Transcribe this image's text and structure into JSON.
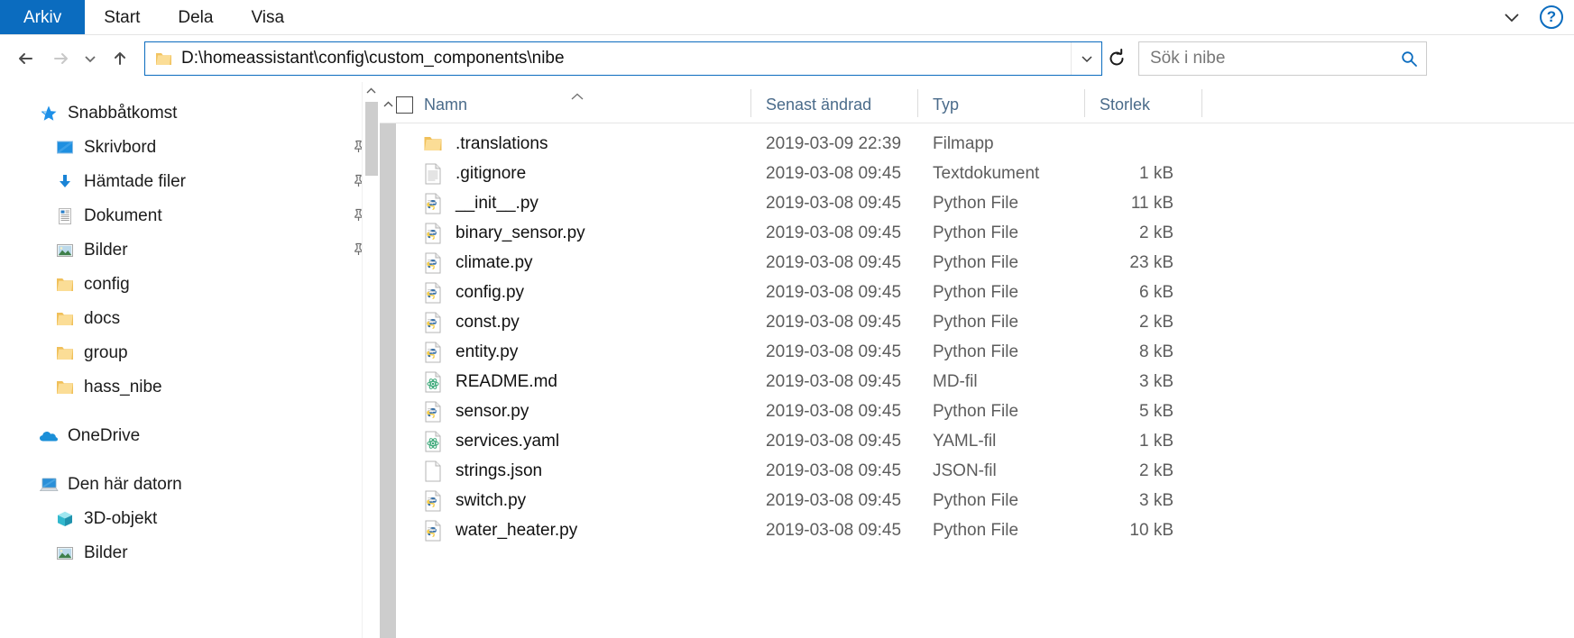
{
  "ribbon": {
    "tabs": [
      {
        "label": "Arkiv",
        "active": true
      },
      {
        "label": "Start",
        "active": false
      },
      {
        "label": "Dela",
        "active": false
      },
      {
        "label": "Visa",
        "active": false
      }
    ],
    "collapse_icon": "chevron-down-icon",
    "help_label": "?"
  },
  "toolbar": {
    "back_glyph": "←",
    "forward_glyph": "→",
    "recent_glyph": "⌄",
    "up_glyph": "↑",
    "refresh_glyph": "↻",
    "address_value": "D:\\homeassistant\\config\\custom_components\\nibe",
    "address_chevron": "⌄",
    "search_placeholder": "Sök i nibe",
    "search_icon": "search-icon"
  },
  "sidebar": {
    "groups": [
      {
        "name": "quick-access",
        "items": [
          {
            "label": "Snabbåtkomst",
            "icon": "star-icon",
            "level": 0,
            "pinned": false
          },
          {
            "label": "Skrivbord",
            "icon": "desktop-icon",
            "level": 1,
            "pinned": true
          },
          {
            "label": "Hämtade filer",
            "icon": "downloads-icon",
            "level": 1,
            "pinned": true
          },
          {
            "label": "Dokument",
            "icon": "documents-icon",
            "level": 1,
            "pinned": true
          },
          {
            "label": "Bilder",
            "icon": "pictures-icon",
            "level": 1,
            "pinned": true
          },
          {
            "label": "config",
            "icon": "folder-icon",
            "level": 1,
            "pinned": false
          },
          {
            "label": "docs",
            "icon": "folder-icon",
            "level": 1,
            "pinned": false
          },
          {
            "label": "group",
            "icon": "folder-icon",
            "level": 1,
            "pinned": false
          },
          {
            "label": "hass_nibe",
            "icon": "folder-icon",
            "level": 1,
            "pinned": false
          }
        ]
      },
      {
        "name": "onedrive",
        "items": [
          {
            "label": "OneDrive",
            "icon": "cloud-icon",
            "level": 0,
            "pinned": false
          }
        ]
      },
      {
        "name": "this-pc",
        "items": [
          {
            "label": "Den här datorn",
            "icon": "computer-icon",
            "level": 0,
            "pinned": false
          },
          {
            "label": "3D-objekt",
            "icon": "cube-icon",
            "level": 1,
            "pinned": false
          },
          {
            "label": "Bilder",
            "icon": "pictures-icon",
            "level": 1,
            "pinned": false
          }
        ]
      }
    ]
  },
  "filelist": {
    "columns": [
      {
        "key": "name",
        "label": "Namn",
        "sorted": true,
        "sort_glyph": "∧"
      },
      {
        "key": "date",
        "label": "Senast ändrad"
      },
      {
        "key": "type",
        "label": "Typ"
      },
      {
        "key": "size",
        "label": "Storlek"
      }
    ],
    "select_all_checkbox": false,
    "rows": [
      {
        "name": ".translations",
        "icon": "folder-icon",
        "date": "2019-03-09 22:39",
        "type": "Filmapp",
        "size": ""
      },
      {
        "name": ".gitignore",
        "icon": "text-file-icon",
        "date": "2019-03-08 09:45",
        "type": "Textdokument",
        "size": "1 kB"
      },
      {
        "name": "__init__.py",
        "icon": "python-file-icon",
        "date": "2019-03-08 09:45",
        "type": "Python File",
        "size": "11 kB"
      },
      {
        "name": "binary_sensor.py",
        "icon": "python-file-icon",
        "date": "2019-03-08 09:45",
        "type": "Python File",
        "size": "2 kB"
      },
      {
        "name": "climate.py",
        "icon": "python-file-icon",
        "date": "2019-03-08 09:45",
        "type": "Python File",
        "size": "23 kB"
      },
      {
        "name": "config.py",
        "icon": "python-file-icon",
        "date": "2019-03-08 09:45",
        "type": "Python File",
        "size": "6 kB"
      },
      {
        "name": "const.py",
        "icon": "python-file-icon",
        "date": "2019-03-08 09:45",
        "type": "Python File",
        "size": "2 kB"
      },
      {
        "name": "entity.py",
        "icon": "python-file-icon",
        "date": "2019-03-08 09:45",
        "type": "Python File",
        "size": "8 kB"
      },
      {
        "name": "README.md",
        "icon": "atom-file-icon",
        "date": "2019-03-08 09:45",
        "type": "MD-fil",
        "size": "3 kB"
      },
      {
        "name": "sensor.py",
        "icon": "python-file-icon",
        "date": "2019-03-08 09:45",
        "type": "Python File",
        "size": "5 kB"
      },
      {
        "name": "services.yaml",
        "icon": "atom-file-icon",
        "date": "2019-03-08 09:45",
        "type": "YAML-fil",
        "size": "1 kB"
      },
      {
        "name": "strings.json",
        "icon": "blank-file-icon",
        "date": "2019-03-08 09:45",
        "type": "JSON-fil",
        "size": "2 kB"
      },
      {
        "name": "switch.py",
        "icon": "python-file-icon",
        "date": "2019-03-08 09:45",
        "type": "Python File",
        "size": "3 kB"
      },
      {
        "name": "water_heater.py",
        "icon": "python-file-icon",
        "date": "2019-03-08 09:45",
        "type": "Python File",
        "size": "10 kB"
      }
    ]
  },
  "colors": {
    "accent": "#0b6cbf",
    "folder": "#f6d288",
    "header_text": "#4a6b8a",
    "row_text": "#111111",
    "meta_text": "#5d5d5d"
  }
}
